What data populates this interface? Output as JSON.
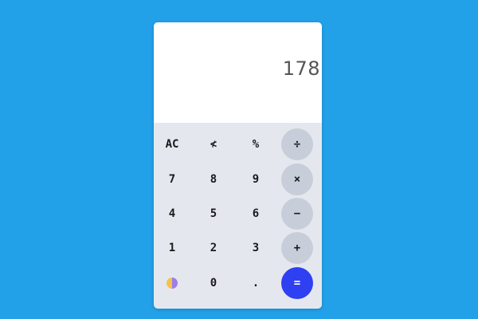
{
  "display": {
    "value": "178"
  },
  "keys": {
    "clear": "AC",
    "backspace": "≮",
    "percent": "%",
    "divide": "÷",
    "seven": "7",
    "eight": "8",
    "nine": "9",
    "multiply": "×",
    "four": "4",
    "five": "5",
    "six": "6",
    "subtract": "−",
    "one": "1",
    "two": "2",
    "three": "3",
    "add": "+",
    "zero": "0",
    "decimal": ".",
    "equals": "="
  },
  "theme_toggle": {
    "icon": "half-circle-theme-icon",
    "colors": [
      "#f7c247",
      "#9e7ee8"
    ]
  },
  "colors": {
    "background": "#22a0e8",
    "display": "#ffffff",
    "keypad": "#e4e8ee",
    "operator_key": "#c8ced9",
    "equals_key": "#2f3ff2"
  }
}
